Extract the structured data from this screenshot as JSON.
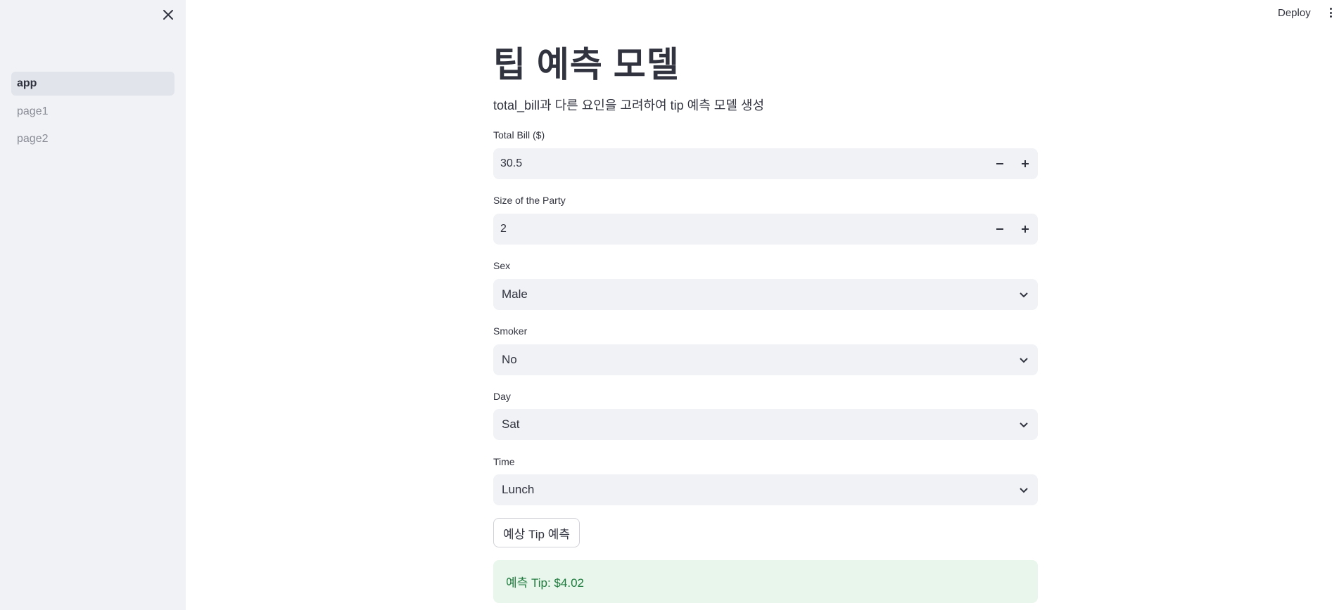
{
  "sidebar": {
    "items": [
      {
        "label": "app",
        "active": true
      },
      {
        "label": "page1",
        "active": false
      },
      {
        "label": "page2",
        "active": false
      }
    ]
  },
  "header": {
    "deploy_label": "Deploy"
  },
  "main": {
    "title": "팁 예측 모델",
    "subtitle": "total_bill과 다른 요인을 고려하여 tip 예측 모델 생성",
    "total_bill": {
      "label": "Total Bill ($)",
      "value": "30.5"
    },
    "party_size": {
      "label": "Size of the Party",
      "value": "2"
    },
    "sex": {
      "label": "Sex",
      "value": "Male"
    },
    "smoker": {
      "label": "Smoker",
      "value": "No"
    },
    "day": {
      "label": "Day",
      "value": "Sat"
    },
    "time": {
      "label": "Time",
      "value": "Lunch"
    },
    "predict_button_label": "예상 Tip 예측",
    "result_text": "예측 Tip: $4.02"
  },
  "colors": {
    "sidebar_bg": "#f0f2f6",
    "input_bg": "#f0f2f6",
    "success_bg": "#e8f6ec",
    "success_text": "#1f7a3d",
    "text": "#31333f"
  }
}
